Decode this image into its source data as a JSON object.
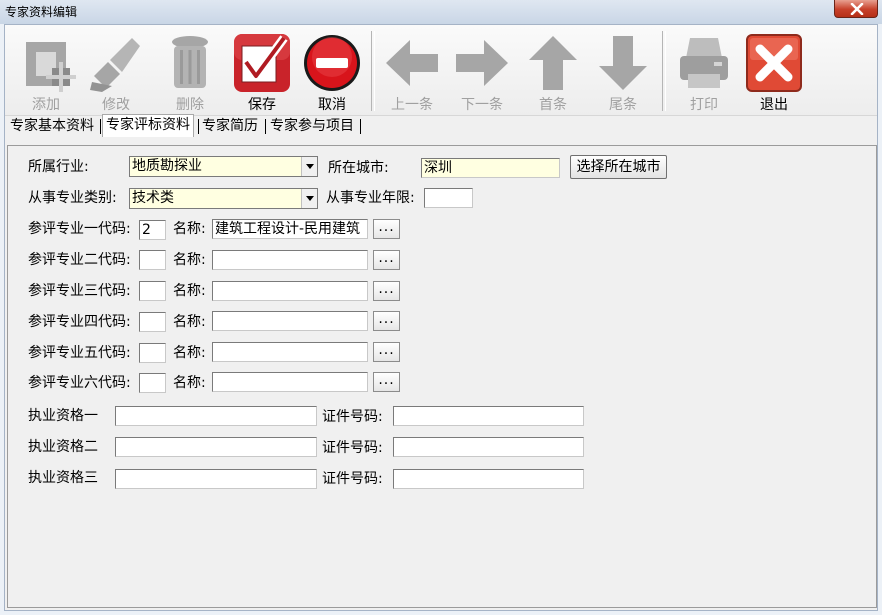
{
  "window": {
    "title": "专家资料编辑"
  },
  "toolbar": {
    "add_label": "添加",
    "edit_label": "修改",
    "delete_label": "删除",
    "save_label": "保存",
    "cancel_label": "取消",
    "prev_label": "上一条",
    "next_label": "下一条",
    "first_label": "首条",
    "last_label": "尾条",
    "print_label": "打印",
    "exit_label": "退出"
  },
  "tabs": [
    "专家基本资料",
    "专家评标资料",
    "专家简历",
    "专家参与项目"
  ],
  "form": {
    "industry_label": "所属行业:",
    "industry_value": "地质勘探业",
    "city_label": "所在城市:",
    "city_value": "深圳",
    "select_city_button": "选择所在城市",
    "category_label": "从事专业类别:",
    "category_value": "技术类",
    "years_label": "从事专业年限:",
    "years_value": "",
    "name_label": "名称:",
    "dots_label": "...",
    "specialties": [
      {
        "label": "参评专业一代码:",
        "code": "2",
        "name": "建筑工程设计-民用建筑"
      },
      {
        "label": "参评专业二代码:",
        "code": "",
        "name": ""
      },
      {
        "label": "参评专业三代码:",
        "code": "",
        "name": ""
      },
      {
        "label": "参评专业四代码:",
        "code": "",
        "name": ""
      },
      {
        "label": "参评专业五代码:",
        "code": "",
        "name": ""
      },
      {
        "label": "参评专业六代码:",
        "code": "",
        "name": ""
      }
    ],
    "cert_number_label": "证件号码:",
    "qualifications": [
      {
        "label": "执业资格一",
        "value": "",
        "cert": ""
      },
      {
        "label": "执业资格二",
        "value": "",
        "cert": ""
      },
      {
        "label": "执业资格三",
        "value": "",
        "cert": ""
      }
    ]
  },
  "colors": {
    "save_red": "#c9232a",
    "cancel_red": "#d8141b",
    "exit_red": "#e04a35",
    "disabled_gray": "#a6a6a6",
    "field_yellow": "#ffffe1"
  }
}
